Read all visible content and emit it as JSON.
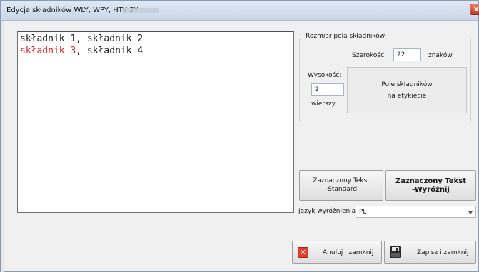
{
  "window": {
    "title": "Edycja składników WLY, WPY, HTY 3Y",
    "close_label": "x"
  },
  "editor": {
    "line1": "składnik 1, składnik 2",
    "line2_red": "składnik 3",
    "line2_rest": ", składnik 4"
  },
  "size_group": {
    "title": "Rozmiar pola składników",
    "width_label": "Szerokość:",
    "width_value": "22",
    "width_unit": "znaków",
    "height_label": "Wysokość:",
    "height_value": "2",
    "height_unit": "wierszy",
    "preview_line1": "Pole składników",
    "preview_line2": "na etykiecie"
  },
  "format_buttons": {
    "standard_line1": "Zaznaczony Tekst",
    "standard_line2": "-Standard",
    "highlight_line1": "Zaznaczony Tekst",
    "highlight_line2": "-Wyróżnij"
  },
  "language": {
    "label": "Język wyróżnienia",
    "selected": "PL"
  },
  "grip": ".....",
  "actions": {
    "cancel_label": "Anuluj i zamknij",
    "save_label": "Zapisz i zamknij"
  },
  "colors": {
    "highlight": "#e02020",
    "accent": "#c1391d"
  }
}
